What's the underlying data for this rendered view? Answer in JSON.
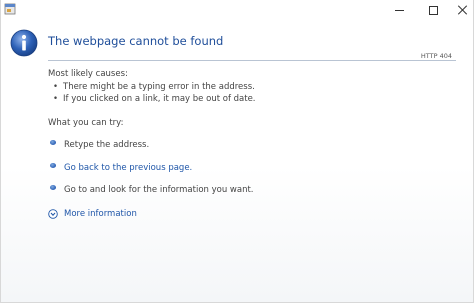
{
  "window": {
    "minimize_icon": "minimize-icon",
    "maximize_icon": "maximize-icon",
    "close_icon": "close-icon"
  },
  "page": {
    "title": "The webpage cannot be found",
    "http_code": "HTTP 404",
    "info_icon": "info-icon"
  },
  "causes": {
    "label": "Most likely causes:",
    "items": [
      "There might be a typing error in the address.",
      "If you clicked on a link, it may be out of date."
    ]
  },
  "try": {
    "label": "What you can try:",
    "items": [
      "Retype the address.",
      "Go back to the previous page.",
      "Go to  and look for the information you want."
    ]
  },
  "more": {
    "label": "More information",
    "icon": "expand-down-icon"
  },
  "colors": {
    "title": "#1f4e9a",
    "link": "#1f56a8",
    "text": "#444444",
    "rule": "#b9c4d3"
  }
}
